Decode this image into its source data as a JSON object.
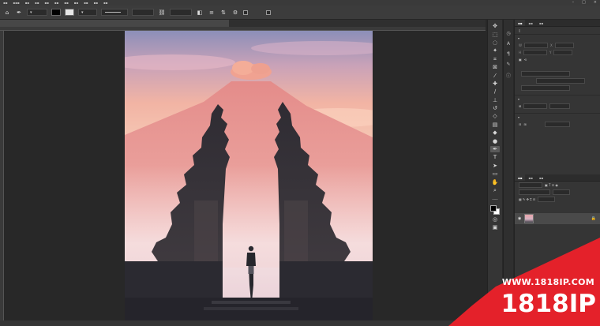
{
  "watermark": {
    "url": "WWW.1818IP.COM",
    "brand": "1818IP"
  },
  "colors": {
    "watermark_red": "#e4212a",
    "workspace": "#282828",
    "panel": "#353535"
  },
  "icons": {
    "toolbar": [
      "move-icon",
      "marquee-icon",
      "lasso-icon",
      "magic-wand-icon",
      "crop-icon",
      "frame-icon",
      "eyedropper-icon",
      "healing-brush-icon",
      "brush-icon",
      "clone-stamp-icon",
      "history-brush-icon",
      "eraser-icon",
      "gradient-icon",
      "blur-icon",
      "dodge-icon",
      "pen-icon",
      "type-icon",
      "path-selection-icon",
      "rectangle-icon",
      "hand-icon",
      "zoom-icon",
      "more-tools-icon"
    ]
  }
}
